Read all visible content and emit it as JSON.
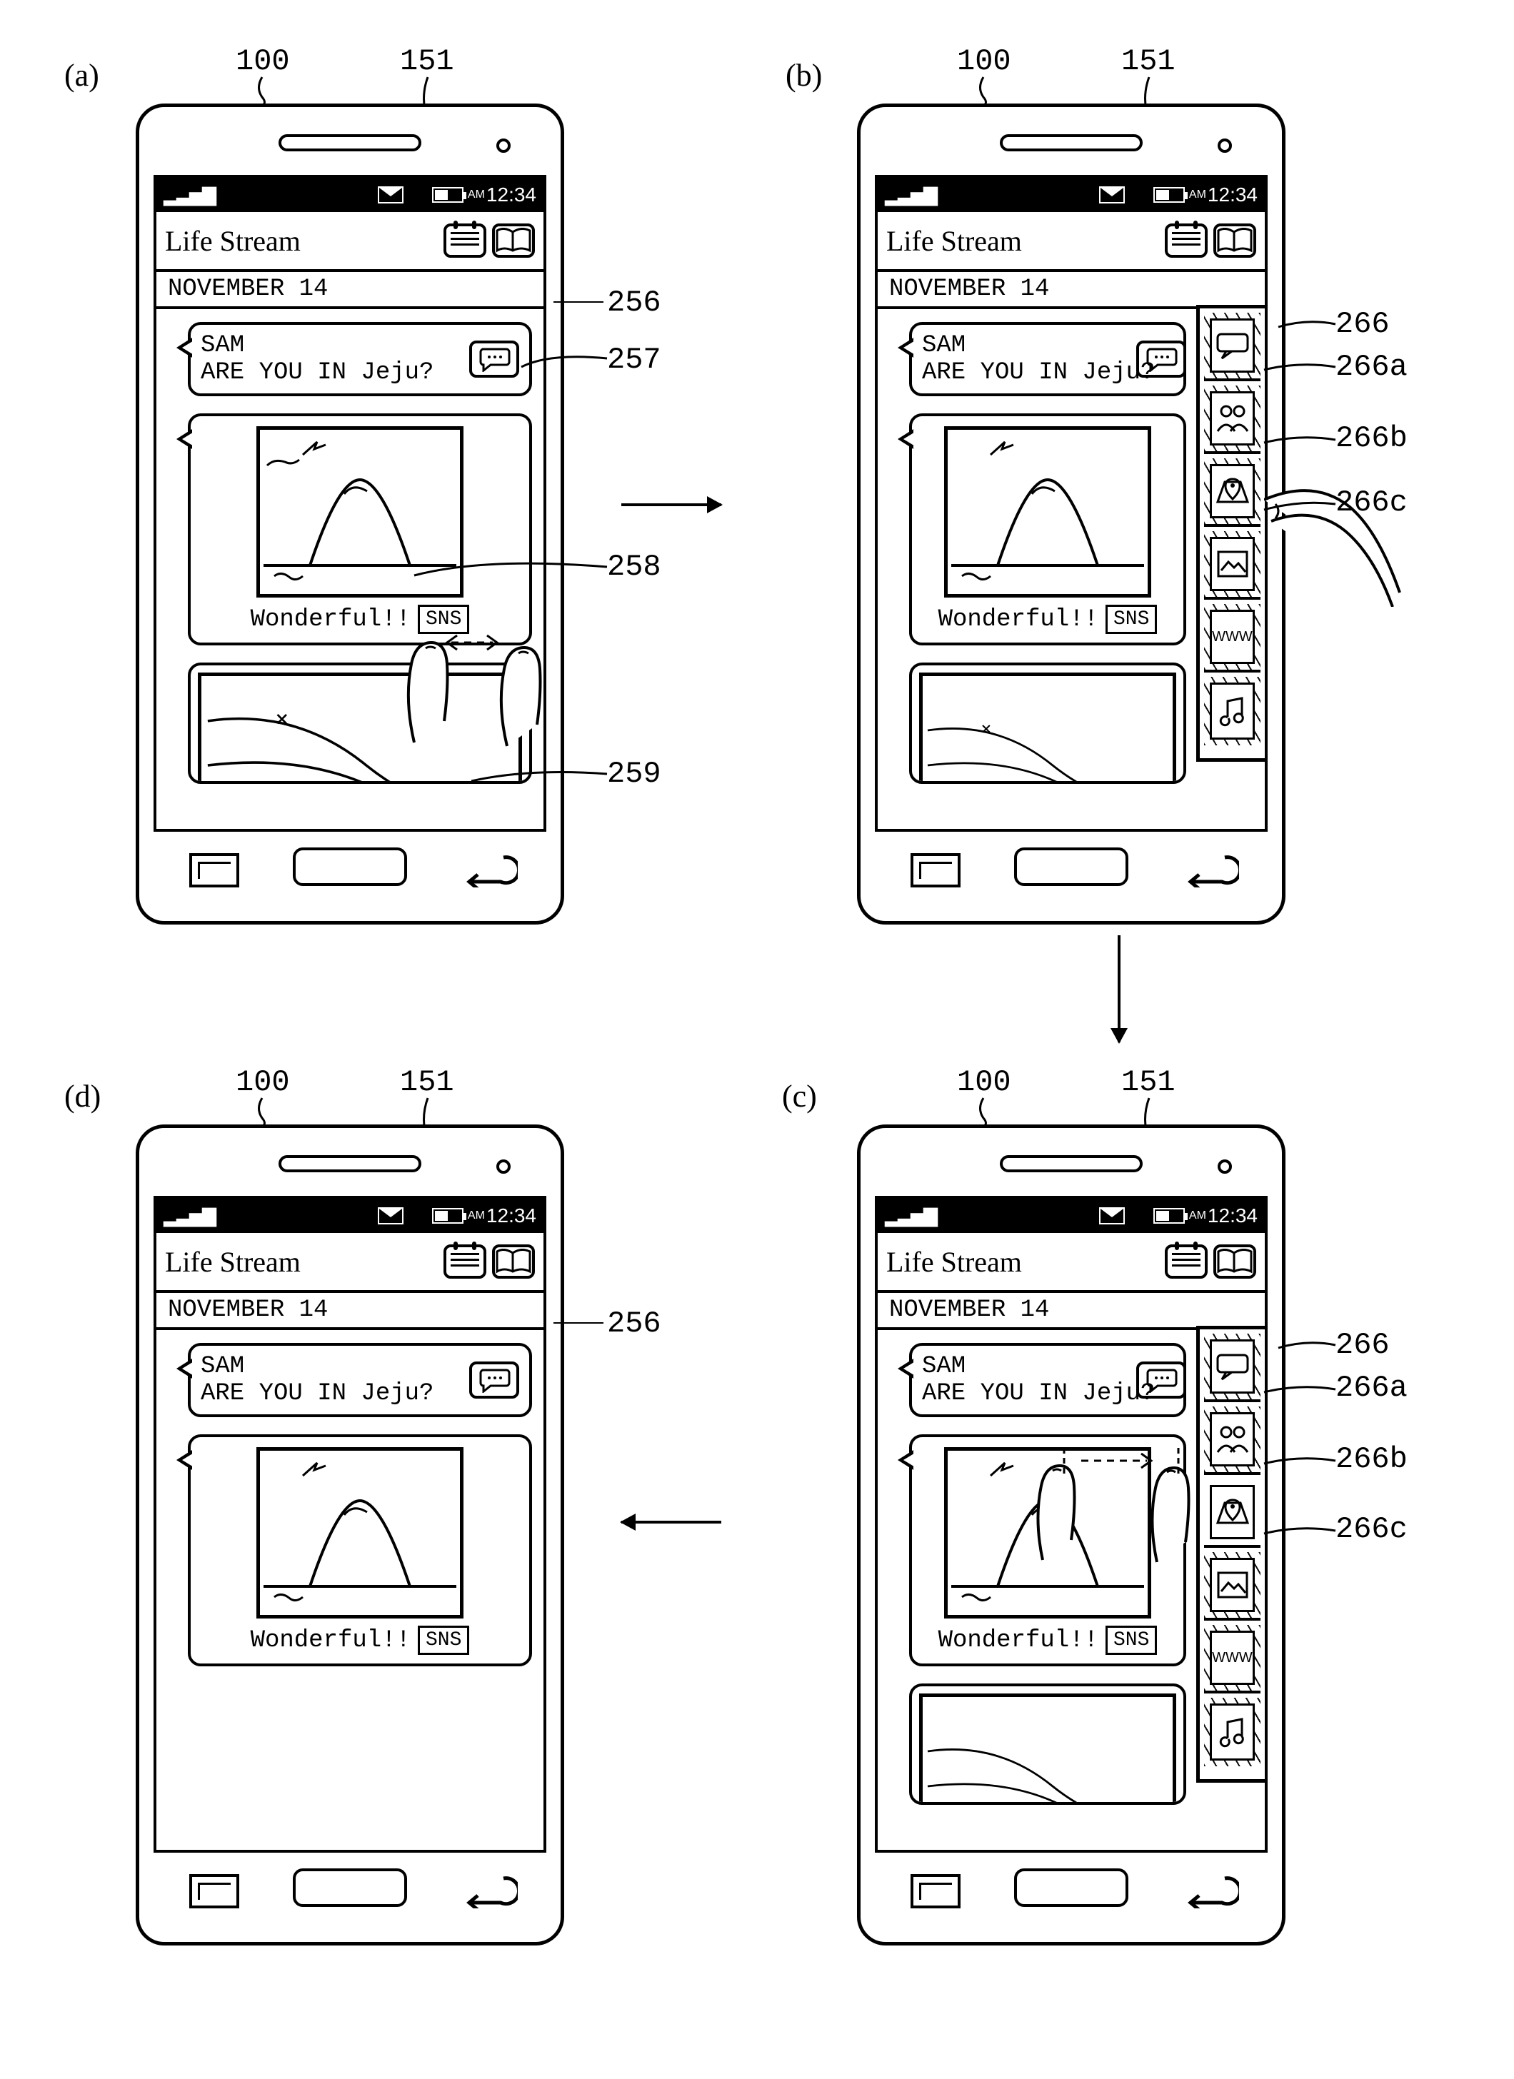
{
  "panels": {
    "a": "(a)",
    "b": "(b)",
    "c": "(c)",
    "d": "(d)"
  },
  "refs": {
    "r100": "100",
    "r151": "151",
    "r256": "256",
    "r257": "257",
    "r258": "258",
    "r259": "259",
    "r266": "266",
    "r266a": "266a",
    "r266b": "266b",
    "r266c": "266c"
  },
  "status": {
    "signal": "▝▚▌▌▌",
    "ampm": "AM",
    "time": "12:34"
  },
  "header": {
    "title": "Life Stream"
  },
  "date": "NOVEMBER 14",
  "msg": {
    "name": "SAM",
    "text": "ARE YOU IN Jeju?"
  },
  "photo": {
    "caption": "Wonderful!!",
    "badge": "SNS"
  },
  "tray": {
    "www": "WWW"
  },
  "nav": {
    "back_glyph": "⮌"
  }
}
